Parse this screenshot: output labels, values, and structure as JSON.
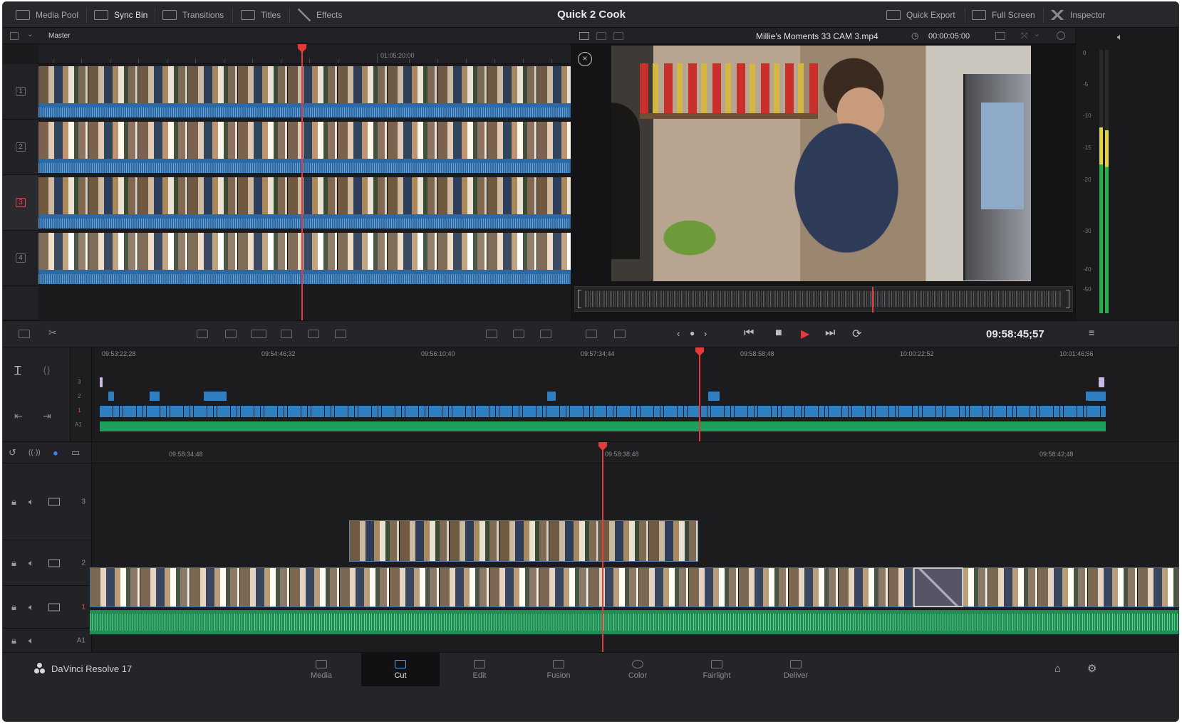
{
  "app": {
    "title": "Quick 2 Cook",
    "product": "DaVinci Resolve 17"
  },
  "topbar": {
    "left_buttons": [
      "Media Pool",
      "Sync Bin",
      "Transitions",
      "Titles",
      "Effects"
    ],
    "right_buttons": [
      "Quick Export",
      "Full Screen",
      "Inspector"
    ]
  },
  "source": {
    "bin_label": "Master",
    "ruler_timecode": "01:05:20:00",
    "tracks": [
      "1",
      "2",
      "3",
      "4"
    ],
    "active_track": "3"
  },
  "viewer": {
    "clip_name": "Millie's Moments 33 CAM 3.mp4",
    "duration": "00:00:05:00",
    "close_icon": "close-circle-icon",
    "scrub_progress": 0.6
  },
  "meters": {
    "db_labels": [
      "0",
      "-5",
      "-10",
      "-15",
      "-20",
      "-30",
      "-40",
      "-50"
    ],
    "levels": [
      0.55,
      0.52
    ]
  },
  "toolbar": {
    "timecode": "09:58:45;57"
  },
  "upper_timeline": {
    "ruler": [
      "09:53:22;28",
      "09:54:46;32",
      "09:56:10;40",
      "09:57:34;44",
      "09:58:58;48",
      "10:00:22;52",
      "10:01:46;56"
    ],
    "tracks": [
      "3",
      "2",
      "1",
      "A1"
    ]
  },
  "lower_timeline": {
    "ruler": [
      "09:58:34;48",
      "09:58:38;48",
      "09:58:42;48"
    ],
    "tracks": [
      "3",
      "2",
      "1",
      "A1"
    ]
  },
  "nav": {
    "pages": [
      "Media",
      "Cut",
      "Edit",
      "Fusion",
      "Color",
      "Fairlight",
      "Deliver"
    ],
    "active_page": "Cut"
  },
  "colors": {
    "playhead": "#e53a3a",
    "clip_blue": "#2f7fc1",
    "audio_green": "#1f9f5d"
  }
}
